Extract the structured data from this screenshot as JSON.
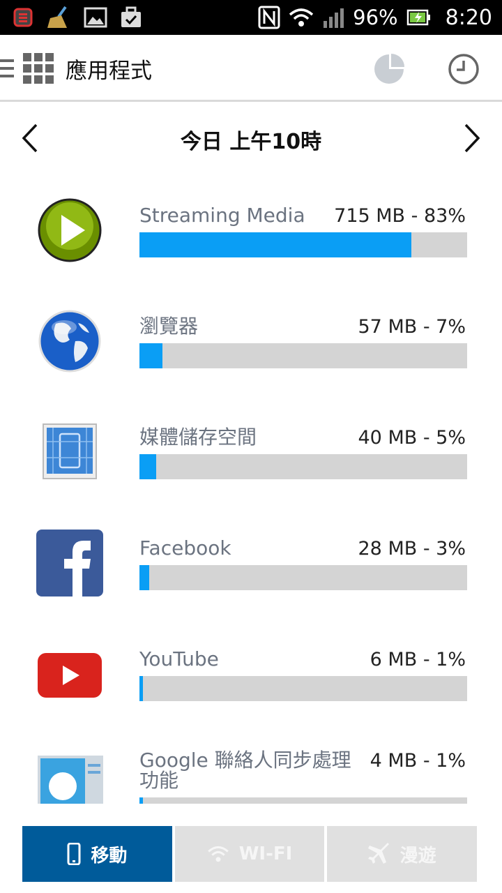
{
  "status_bar": {
    "battery": "96%",
    "time": "8:20",
    "icons": [
      "notification-app-icon",
      "broom-icon",
      "image-icon",
      "briefcase-icon",
      "nfc-icon",
      "wifi-icon",
      "signal-icon",
      "battery-icon"
    ]
  },
  "header": {
    "title": "應用程式",
    "icons": [
      "menu-icon",
      "apps-grid-icon",
      "pie-chart-icon",
      "clock-icon"
    ]
  },
  "date_nav": {
    "label": "今日 上午10時"
  },
  "apps": [
    {
      "name": "Streaming Media",
      "usage": "715 MB - 83%",
      "percent": 83,
      "icon": "play-icon"
    },
    {
      "name": "瀏覽器",
      "usage": "57 MB - 7%",
      "percent": 7,
      "icon": "globe-icon"
    },
    {
      "name": "媒體儲存空間",
      "usage": "40 MB - 5%",
      "percent": 5,
      "icon": "media-storage-icon"
    },
    {
      "name": "Facebook",
      "usage": "28 MB - 3%",
      "percent": 3,
      "icon": "facebook-icon"
    },
    {
      "name": "YouTube",
      "usage": "6 MB - 1%",
      "percent": 1,
      "icon": "youtube-icon"
    },
    {
      "name": "Google 聯絡人同步處理功能",
      "usage": "4 MB - 1%",
      "percent": 1,
      "icon": "contacts-icon"
    }
  ],
  "tabs": [
    {
      "label": "移動",
      "icon": "phone-icon",
      "active": true
    },
    {
      "label": "WI-FI",
      "icon": "wifi-icon",
      "active": false
    },
    {
      "label": "漫遊",
      "icon": "airplane-icon",
      "active": false
    }
  ],
  "colors": {
    "bar_fill": "#0a9ef5",
    "bar_track": "#d4d4d4",
    "tab_active": "#005b9a",
    "tab_inactive": "#e0e0e0"
  }
}
